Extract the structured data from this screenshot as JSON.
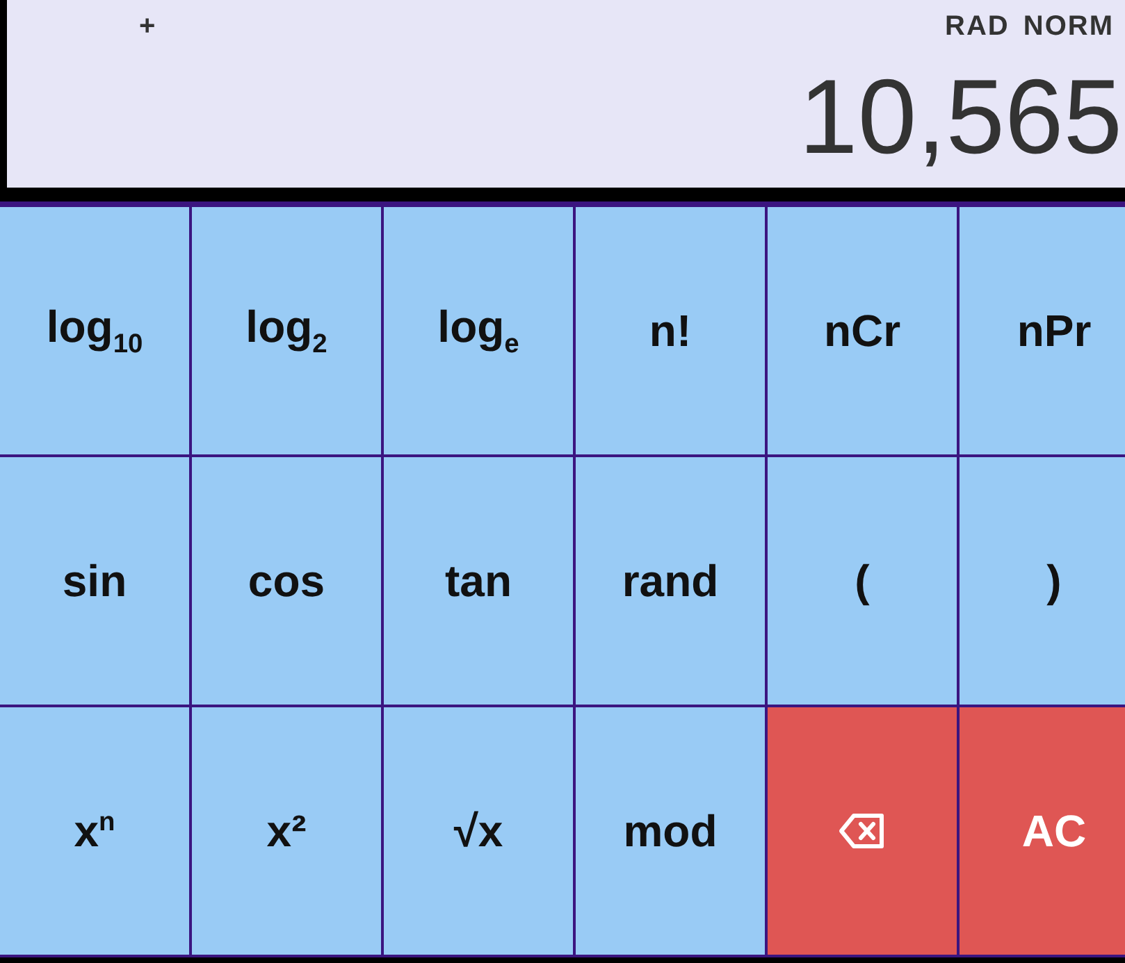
{
  "display": {
    "operator": "+",
    "modes": [
      "RAD",
      "NORM"
    ],
    "value": "10,565"
  },
  "keys": [
    {
      "label": "log$_{10}$",
      "kind": "function"
    },
    {
      "label": "log$_{2}$",
      "kind": "function"
    },
    {
      "label": "log$_{e}$",
      "kind": "function"
    },
    {
      "label": "n!",
      "kind": "function"
    },
    {
      "label": "nCr",
      "kind": "function"
    },
    {
      "label": "nPr",
      "kind": "function"
    },
    {
      "label": "sin",
      "kind": "function"
    },
    {
      "label": "cos",
      "kind": "function"
    },
    {
      "label": "tan",
      "kind": "function"
    },
    {
      "label": "rand",
      "kind": "function"
    },
    {
      "label": "(",
      "kind": "function"
    },
    {
      "label": ")",
      "kind": "function"
    },
    {
      "label": "x$^{n}$",
      "kind": "function"
    },
    {
      "label": "x²",
      "kind": "function"
    },
    {
      "label": "√x",
      "kind": "function"
    },
    {
      "label": "mod",
      "kind": "function"
    },
    {
      "kind": "backspace"
    },
    {
      "label": "AC",
      "kind": "clear"
    }
  ]
}
